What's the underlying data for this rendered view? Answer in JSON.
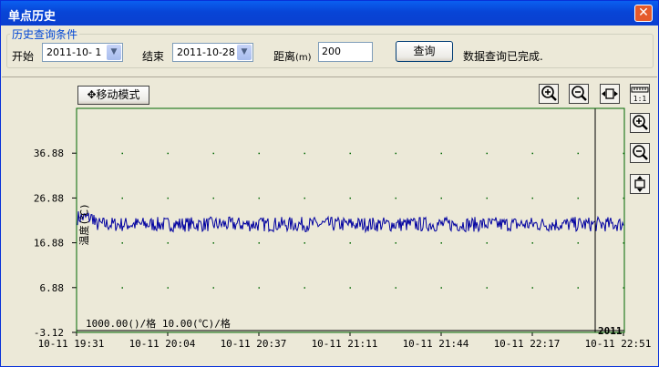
{
  "window": {
    "title": "单点历史",
    "close_glyph": "✕"
  },
  "query": {
    "group_label": "历史查询条件",
    "start_label": "开始",
    "start_value": "2011-10- 1",
    "end_label": "结束",
    "end_value": "2011-10-28",
    "distance_label": "距离",
    "distance_unit": "(m)",
    "distance_value": "200",
    "query_button": "查询",
    "status_text": "数据查询已完成."
  },
  "chart": {
    "move_mode_label": "移动模式",
    "top_tools": [
      "zoom-in-icon",
      "zoom-out-icon",
      "fit-horizontal-icon",
      "ruler-1-1-icon"
    ],
    "side_tools": [
      "zoom-in-icon",
      "zoom-out-icon",
      "fit-vertical-icon"
    ],
    "ruler_label": "1:1",
    "scale_text": "1000.00()/格 10.00(℃)/格",
    "year_marker": "2011",
    "line_color": "#0000A0",
    "grid_color": "#006600"
  },
  "chart_data": {
    "type": "line",
    "ylabel": "温度(℃)",
    "ylim": [
      -3.12,
      46.88
    ],
    "y_ticks": [
      "36.88",
      "26.88",
      "16.88",
      "6.88",
      "-3.12"
    ],
    "x_ticks": [
      "10-11 19:31",
      "10-11 20:04",
      "10-11 20:37",
      "10-11 21:11",
      "10-11 21:44",
      "10-11 22:17",
      "10-11 22:51"
    ],
    "series": [
      {
        "approx_mean": 21.0,
        "range": [
          18.5,
          24.5
        ]
      }
    ]
  }
}
